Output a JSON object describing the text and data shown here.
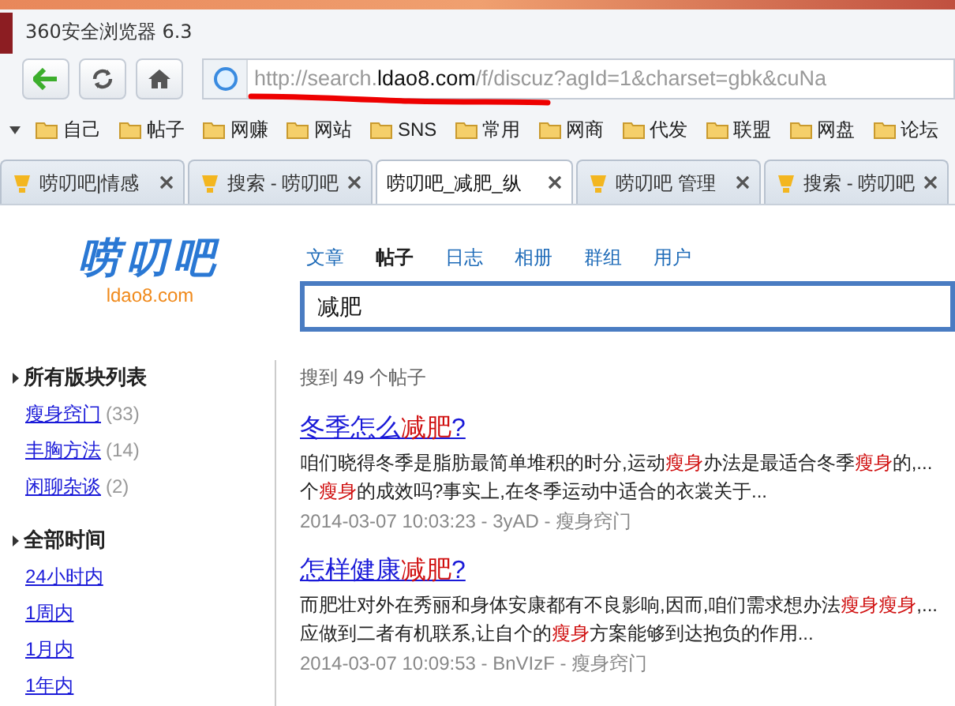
{
  "window": {
    "title": "360安全浏览器 6.3"
  },
  "address_bar": {
    "url": [
      {
        "text": "http://search.",
        "highlight": false
      },
      {
        "text": "ldao8.com",
        "highlight": true
      },
      {
        "text": "/f/discuz?agId=1&charset=gbk&cuNa",
        "highlight": false
      }
    ]
  },
  "bookmarks": [
    "自己",
    "帖子",
    "网赚",
    "网站",
    "SNS",
    "常用",
    "网商",
    "代发",
    "联盟",
    "网盘",
    "论坛"
  ],
  "tabs": [
    {
      "label": "唠叨吧|情感",
      "selected": false
    },
    {
      "label": "搜索 - 唠叨吧",
      "selected": false
    },
    {
      "label": "唠叨吧_减肥_纵",
      "selected": true
    },
    {
      "label": "唠叨吧 管理",
      "selected": false
    },
    {
      "label": "搜索 - 唠叨吧",
      "selected": false
    }
  ],
  "logo": {
    "name": "唠叨吧",
    "domain": "ldao8.com"
  },
  "search_tabs": [
    {
      "label": "文章",
      "selected": false
    },
    {
      "label": "帖子",
      "selected": true
    },
    {
      "label": "日志",
      "selected": false
    },
    {
      "label": "相册",
      "selected": false
    },
    {
      "label": "群组",
      "selected": false
    },
    {
      "label": "用户",
      "selected": false
    }
  ],
  "search": {
    "value": "减肥"
  },
  "sidebar": [
    {
      "title": "所有版块列表",
      "items": [
        {
          "label": "瘦身窍门",
          "count": "(33)"
        },
        {
          "label": "丰胸方法",
          "count": "(14)"
        },
        {
          "label": "闲聊杂谈",
          "count": "(2)"
        }
      ]
    },
    {
      "title": "全部时间",
      "items": [
        {
          "label": "24小时内"
        },
        {
          "label": "1周内"
        },
        {
          "label": "1月内"
        },
        {
          "label": "1年内"
        }
      ]
    }
  ],
  "result_count": "搜到 49 个帖子",
  "results": [
    {
      "title": [
        {
          "text": "冬季怎么",
          "highlight": false
        },
        {
          "text": "减肥",
          "highlight": true
        },
        {
          "text": "?",
          "highlight": false
        }
      ],
      "snippet": [
        [
          {
            "text": "咱们晓得冬季是脂肪最简单堆积的时分,运动",
            "highlight": false
          },
          {
            "text": "瘦身",
            "highlight": true
          },
          {
            "text": "办法是最适合冬季",
            "highlight": false
          },
          {
            "text": "瘦身",
            "highlight": true
          },
          {
            "text": "的,...",
            "highlight": false
          }
        ],
        [
          {
            "text": "个",
            "highlight": false
          },
          {
            "text": "瘦身",
            "highlight": true
          },
          {
            "text": "的成效吗?事实上,在冬季运动中适合的衣裳关于...",
            "highlight": false
          }
        ]
      ],
      "meta": "2014-03-07 10:03:23 - 3yAD - 瘦身窍门"
    },
    {
      "title": [
        {
          "text": "怎样健康",
          "highlight": false
        },
        {
          "text": "减肥",
          "highlight": true
        },
        {
          "text": "?",
          "highlight": false
        }
      ],
      "snippet": [
        [
          {
            "text": "而肥壮对外在秀丽和身体安康都有不良影响,因而,咱们需求想办法",
            "highlight": false
          },
          {
            "text": "瘦身瘦身",
            "highlight": true
          },
          {
            "text": ",...",
            "highlight": false
          }
        ],
        [
          {
            "text": "应做到二者有机联系,让自个的",
            "highlight": false
          },
          {
            "text": "瘦身",
            "highlight": true
          },
          {
            "text": "方案能够到达抱负的作用...",
            "highlight": false
          }
        ]
      ],
      "meta": "2014-03-07 10:09:53 - BnVIzF - 瘦身窍门"
    }
  ]
}
